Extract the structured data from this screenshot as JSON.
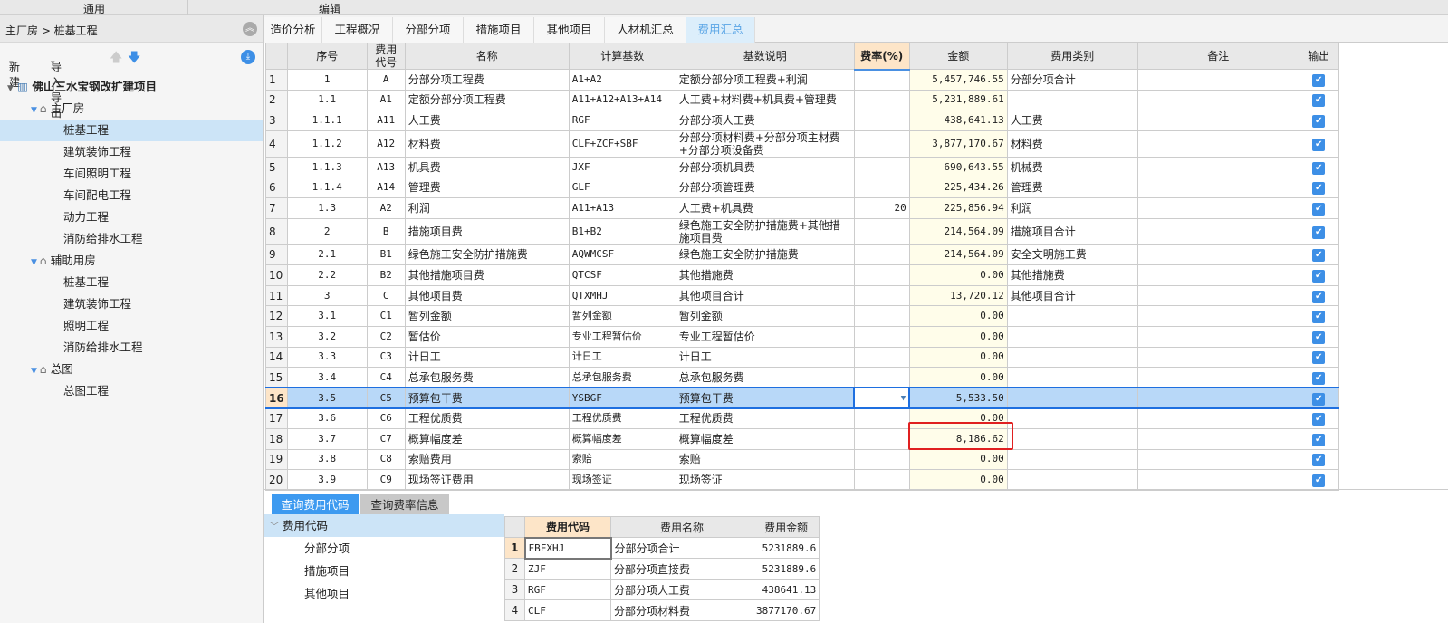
{
  "menubar": {
    "general": "通用",
    "edit": "编辑"
  },
  "breadcrumb": "主厂房 > 桩基工程",
  "toolbar": {
    "new": "新建",
    "import_export": "导入导出"
  },
  "tree": {
    "project": "佛山三水宝钢改扩建项目",
    "items": [
      {
        "label": "主厂房",
        "level": 1,
        "folder": true
      },
      {
        "label": "桩基工程",
        "level": 2,
        "selected": true
      },
      {
        "label": "建筑装饰工程",
        "level": 2
      },
      {
        "label": "车间照明工程",
        "level": 2
      },
      {
        "label": "车间配电工程",
        "level": 2
      },
      {
        "label": "动力工程",
        "level": 2
      },
      {
        "label": "消防给排水工程",
        "level": 2
      },
      {
        "label": "辅助用房",
        "level": 1,
        "folder": true
      },
      {
        "label": "桩基工程",
        "level": 2
      },
      {
        "label": "建筑装饰工程",
        "level": 2
      },
      {
        "label": "照明工程",
        "level": 2
      },
      {
        "label": "消防给排水工程",
        "level": 2
      },
      {
        "label": "总图",
        "level": 1,
        "folder": true
      },
      {
        "label": "总图工程",
        "level": 2
      }
    ]
  },
  "tabs": [
    "造价分析",
    "工程概况",
    "分部分项",
    "措施项目",
    "其他项目",
    "人材机汇总",
    "费用汇总"
  ],
  "active_tab": 6,
  "columns": [
    "序号",
    "费用代号",
    "名称",
    "计算基数",
    "基数说明",
    "费率(%)",
    "金额",
    "费用类别",
    "备注",
    "输出"
  ],
  "rows": [
    [
      "1",
      "A",
      "分部分项工程费",
      "A1+A2",
      "定额分部分项工程费+利润",
      "",
      "5,457,746.55",
      "分部分项合计",
      ""
    ],
    [
      "1.1",
      "A1",
      "定额分部分项工程费",
      "A11+A12+A13+A14",
      "人工费+材料费+机具费+管理费",
      "",
      "5,231,889.61",
      "",
      ""
    ],
    [
      "1.1.1",
      "A11",
      "人工费",
      "RGF",
      "分部分项人工费",
      "",
      "438,641.13",
      "人工费",
      ""
    ],
    [
      "1.1.2",
      "A12",
      "材料费",
      "CLF+ZCF+SBF",
      "分部分项材料费+分部分项主材费+分部分项设备费",
      "",
      "3,877,170.67",
      "材料费",
      ""
    ],
    [
      "1.1.3",
      "A13",
      "机具费",
      "JXF",
      "分部分项机具费",
      "",
      "690,643.55",
      "机械费",
      ""
    ],
    [
      "1.1.4",
      "A14",
      "管理费",
      "GLF",
      "分部分项管理费",
      "",
      "225,434.26",
      "管理费",
      ""
    ],
    [
      "1.3",
      "A2",
      "利润",
      "A11+A13",
      "人工费+机具费",
      "20",
      "225,856.94",
      "利润",
      ""
    ],
    [
      "2",
      "B",
      "措施项目费",
      "B1+B2",
      "绿色施工安全防护措施费+其他措施项目费",
      "",
      "214,564.09",
      "措施项目合计",
      ""
    ],
    [
      "2.1",
      "B1",
      "绿色施工安全防护措施费",
      "AQWMCSF",
      "绿色施工安全防护措施费",
      "",
      "214,564.09",
      "安全文明施工费",
      ""
    ],
    [
      "2.2",
      "B2",
      "其他措施项目费",
      "QTCSF",
      "其他措施费",
      "",
      "0.00",
      "其他措施费",
      ""
    ],
    [
      "3",
      "C",
      "其他项目费",
      "QTXMHJ",
      "其他项目合计",
      "",
      "13,720.12",
      "其他项目合计",
      ""
    ],
    [
      "3.1",
      "C1",
      "暂列金额",
      "暂列金额",
      "暂列金额",
      "",
      "0.00",
      "",
      ""
    ],
    [
      "3.2",
      "C2",
      "暂估价",
      "专业工程暂估价",
      "专业工程暂估价",
      "",
      "0.00",
      "",
      ""
    ],
    [
      "3.3",
      "C3",
      "计日工",
      "计日工",
      "计日工",
      "",
      "0.00",
      "",
      ""
    ],
    [
      "3.4",
      "C4",
      "总承包服务费",
      "总承包服务费",
      "总承包服务费",
      "",
      "0.00",
      "",
      ""
    ],
    [
      "3.5",
      "C5",
      "预算包干费",
      "YSBGF",
      "预算包干费",
      "",
      "5,533.50",
      "",
      ""
    ],
    [
      "3.6",
      "C6",
      "工程优质费",
      "工程优质费",
      "工程优质费",
      "",
      "0.00",
      "",
      ""
    ],
    [
      "3.7",
      "C7",
      "概算幅度差",
      "概算幅度差",
      "概算幅度差",
      "",
      "8,186.62",
      "",
      ""
    ],
    [
      "3.8",
      "C8",
      "索赔费用",
      "索赔",
      "索赔",
      "",
      "0.00",
      "",
      ""
    ],
    [
      "3.9",
      "C9",
      "现场签证费用",
      "现场签证",
      "现场签证",
      "",
      "0.00",
      "",
      ""
    ]
  ],
  "selected_row": 16,
  "bottom_tabs": [
    "查询费用代码",
    "查询费率信息"
  ],
  "code_tree": {
    "root": "费用代码",
    "items": [
      "分部分项",
      "措施项目",
      "其他项目"
    ]
  },
  "sub_columns": [
    "费用代码",
    "费用名称",
    "费用金额"
  ],
  "sub_rows": [
    [
      "1",
      "FBFXHJ",
      "分部分项合计",
      "5231889.6"
    ],
    [
      "2",
      "ZJF",
      "分部分项直接费",
      "5231889.6"
    ],
    [
      "3",
      "RGF",
      "分部分项人工费",
      "438641.13"
    ],
    [
      "4",
      "CLF",
      "分部分项材料费",
      "3877170.67"
    ]
  ]
}
